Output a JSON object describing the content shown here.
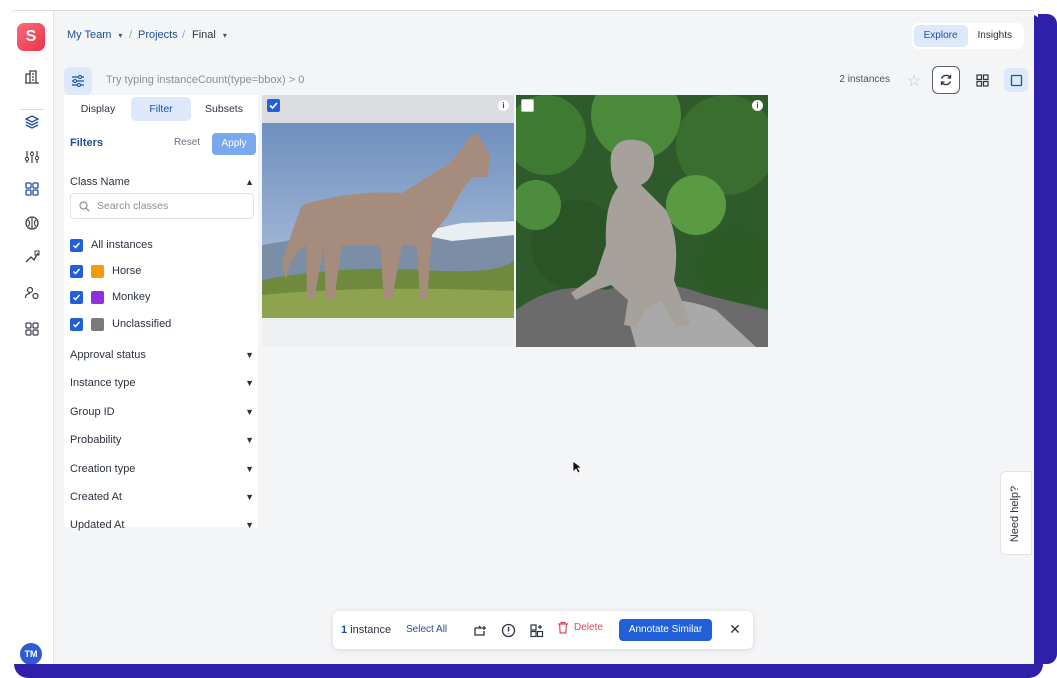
{
  "app": {
    "logo_letter": "S",
    "avatar_initials": "TM"
  },
  "breadcrumb": {
    "team": "My Team",
    "projects": "Projects",
    "project": "Final"
  },
  "view_switch": {
    "explore": "Explore",
    "insights": "Insights",
    "active": "Explore"
  },
  "query": {
    "placeholder": "Try typing instanceCount(type=bbox) > 0",
    "instance_count": "2 instances"
  },
  "panel": {
    "tabs": [
      "Display",
      "Filter",
      "Subsets"
    ],
    "active_tab": "Filter",
    "filters_title": "Filters",
    "reset_label": "Reset",
    "apply_label": "Apply",
    "class_name_label": "Class Name",
    "search_placeholder": "Search classes",
    "classes": [
      {
        "label": "All instances",
        "checked": true,
        "color": null
      },
      {
        "label": "Horse",
        "checked": true,
        "color": "#f59c0b"
      },
      {
        "label": "Monkey",
        "checked": true,
        "color": "#8e2fe0"
      },
      {
        "label": "Unclassified",
        "checked": true,
        "color": "#7a7a7a"
      }
    ],
    "sections": [
      "Approval status",
      "Instance type",
      "Group ID",
      "Probability",
      "Creation type",
      "Created At",
      "Updated At"
    ]
  },
  "gallery": {
    "items": [
      {
        "name": "horse",
        "selected": true
      },
      {
        "name": "monkey",
        "selected": false
      }
    ]
  },
  "actionbar": {
    "count_number": "1",
    "count_label": "instance",
    "select_all": "Select All",
    "delete_label": "Delete",
    "annotate_label": "Annotate Similar"
  },
  "help": {
    "label": "Need help?"
  },
  "colors": {
    "accent": "#2160d8",
    "accent_light": "#dde9fb",
    "delete": "#e0485a",
    "frame": "#2e20a8"
  }
}
